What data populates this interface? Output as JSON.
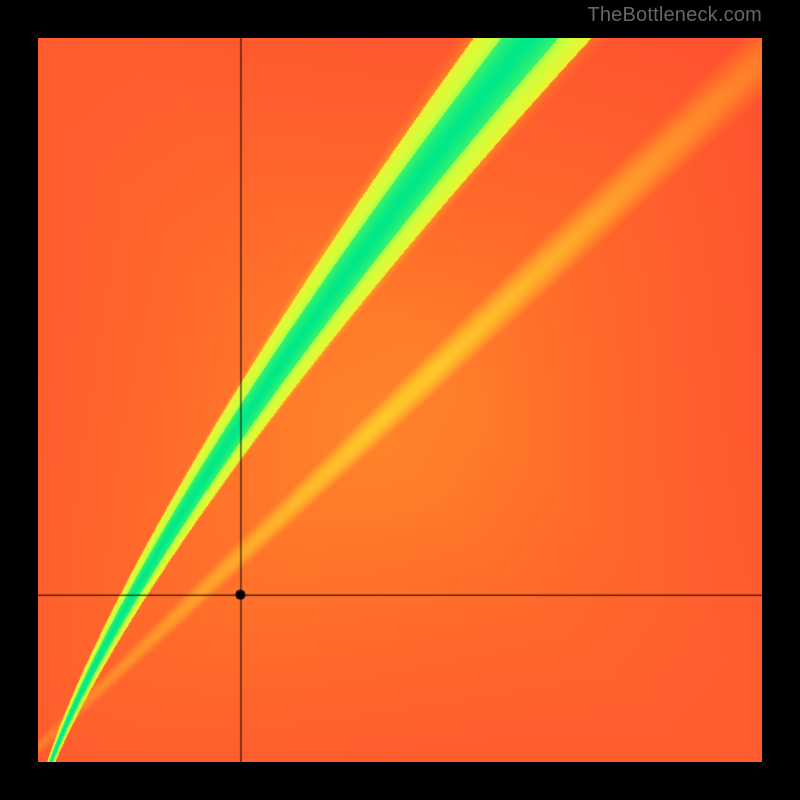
{
  "watermark": "TheBottleneck.com",
  "chart_data": {
    "type": "heatmap",
    "title": "",
    "xlabel": "",
    "ylabel": "",
    "xlim": [
      0,
      1
    ],
    "ylim": [
      0,
      1
    ],
    "crosshair": {
      "x": 0.28,
      "y": 0.23
    },
    "marker": {
      "x": 0.28,
      "y": 0.23
    },
    "optimal_curve_description": "Green optimal band runs diagonally from bottom-left to top-right, curving upward with slope steeper than 1; background is a red-orange-yellow gradient heat field symmetric about the diagonal.",
    "color_scale": [
      "#ff2a3a",
      "#ff6a2a",
      "#ffb92a",
      "#ffe82a",
      "#eaff2a",
      "#7fff2a",
      "#00e888"
    ],
    "grid": false,
    "legend": false
  }
}
